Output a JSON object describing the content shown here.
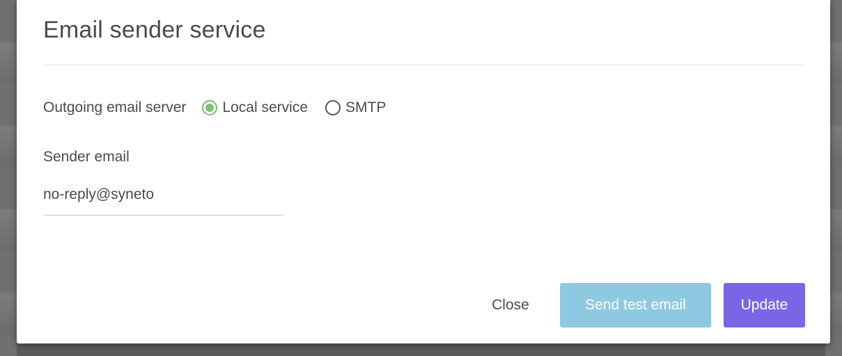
{
  "dialog": {
    "title": "Email sender service"
  },
  "server": {
    "label": "Outgoing email server",
    "options": [
      {
        "label": "Local service",
        "selected": true
      },
      {
        "label": "SMTP",
        "selected": false
      }
    ]
  },
  "sender": {
    "label": "Sender email",
    "value": "no-reply@syneto"
  },
  "actions": {
    "close_label": "Close",
    "test_label": "Send test email",
    "update_label": "Update"
  },
  "colors": {
    "radio_selected": "#7cc36f",
    "test_button": "#8ec9e2",
    "update_button": "#7966e6"
  }
}
